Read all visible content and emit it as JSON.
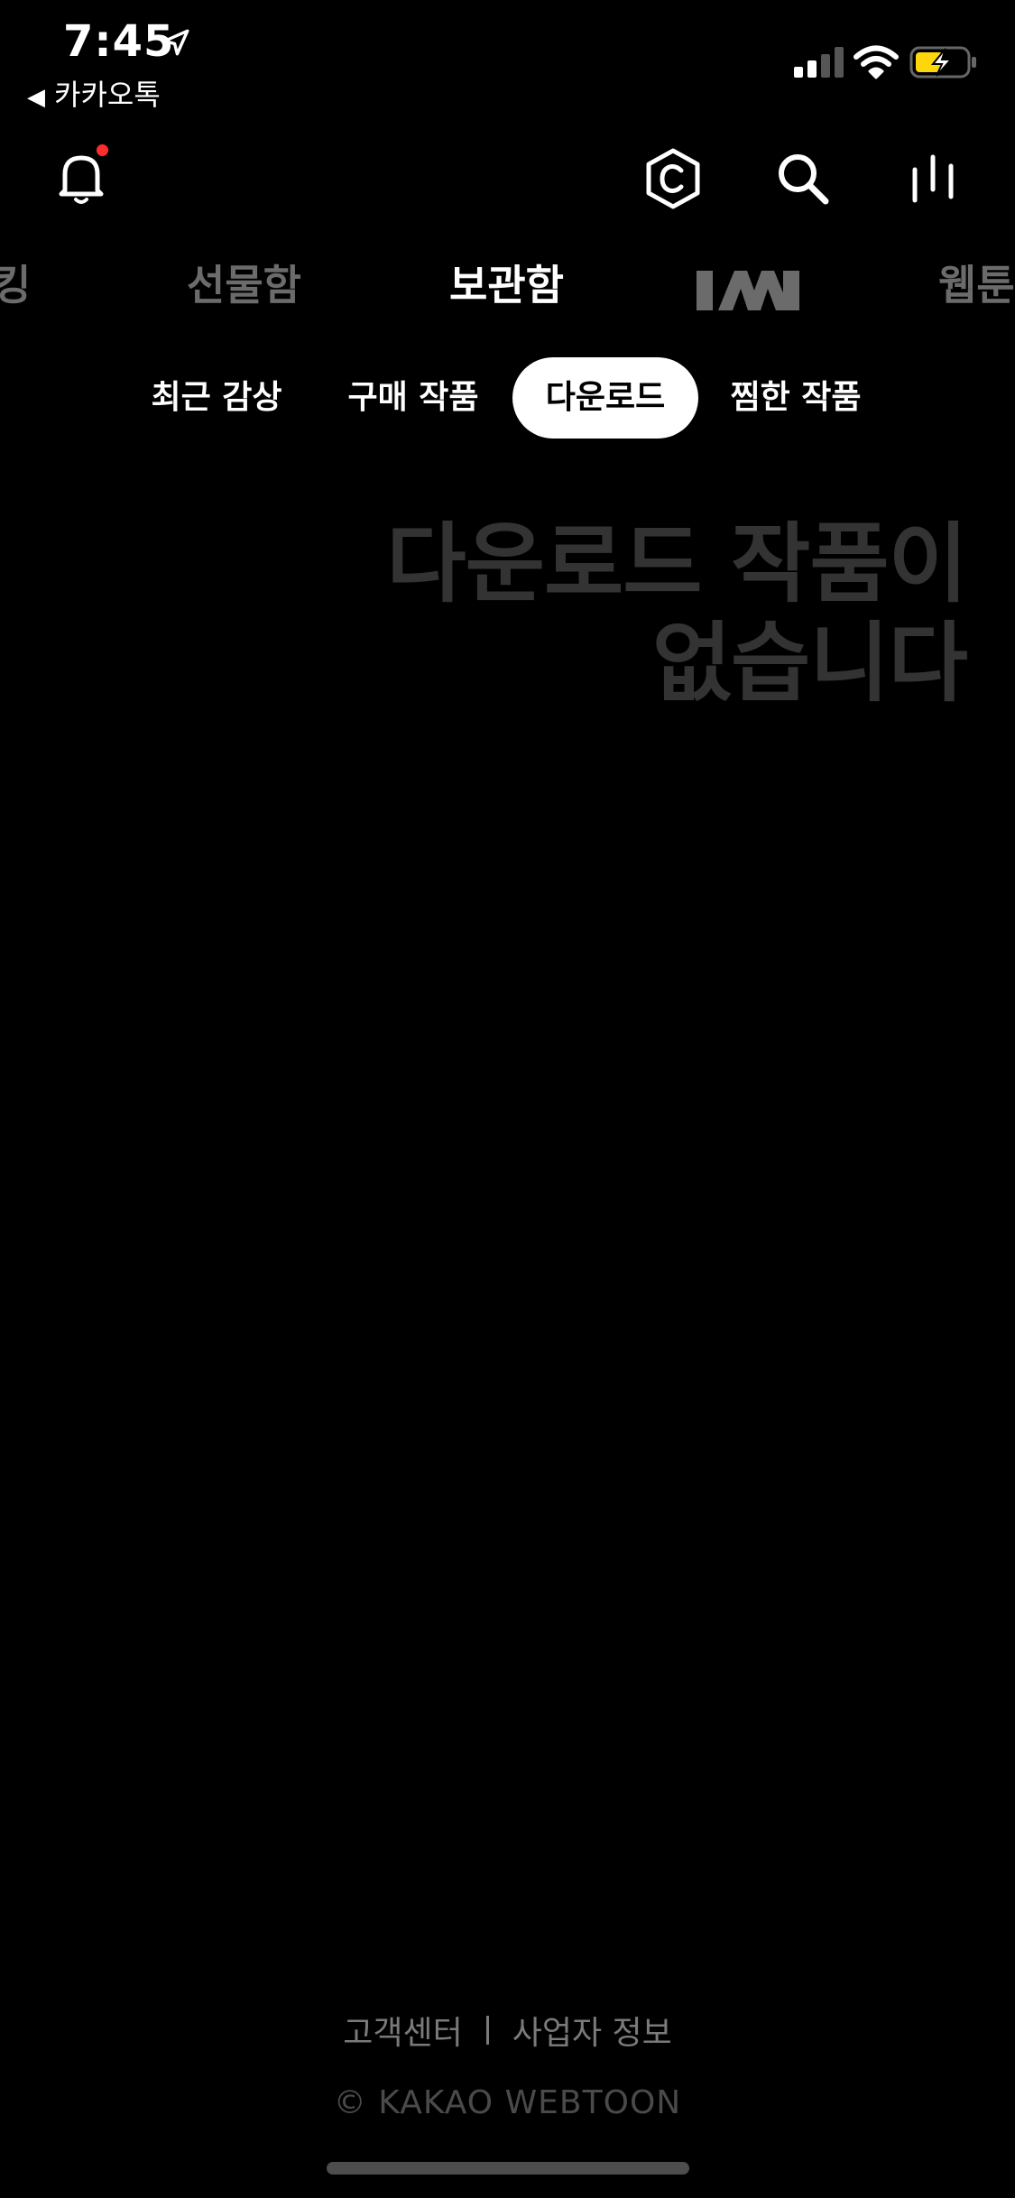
{
  "status_bar": {
    "time": "7:45",
    "back_app": "카카오톡"
  },
  "main_tabs": [
    {
      "label": "킹",
      "active": false
    },
    {
      "label": "선물함",
      "active": false
    },
    {
      "label": "보관함",
      "active": true
    },
    {
      "label": "IAI",
      "active": false
    },
    {
      "label": "웹툰",
      "active": false
    }
  ],
  "sub_tabs": [
    {
      "label": "최근 감상",
      "active": false
    },
    {
      "label": "구매 작품",
      "active": false
    },
    {
      "label": "다운로드",
      "active": true
    },
    {
      "label": "찜한 작품",
      "active": false
    }
  ],
  "empty_state": {
    "line1": "다운로드 작품이",
    "line2": "없습니다"
  },
  "footer": {
    "customer_center": "고객센터",
    "business_info": "사업자 정보",
    "copyright": "© KAKAO WEBTOON"
  },
  "colors": {
    "background": "#000000",
    "notification_dot": "#ff2d2d",
    "battery_charge": "#ffd60a",
    "inactive_tab": "#6b6b6b",
    "empty_text": "#333333"
  }
}
